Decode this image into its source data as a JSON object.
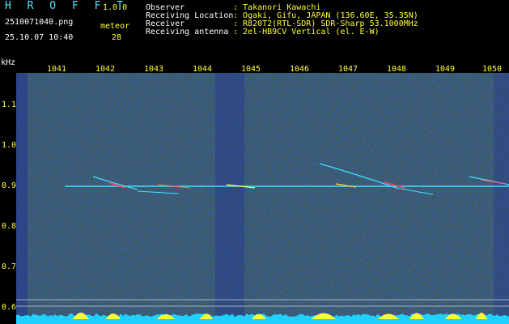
{
  "app": {
    "title": "H R O F F T",
    "version": "1.0.0"
  },
  "file": {
    "name": "2510071040.png",
    "datetime": "25.10.07 10:40"
  },
  "meteor": {
    "label": "meteor",
    "count": "28"
  },
  "info": {
    "labels": [
      "Observer",
      "Receiving Location",
      "Receiver",
      "Receiving antenna"
    ],
    "values": [
      ": Takanori Kawachi",
      ": Ogaki, Gifu, JAPAN (136.60E, 35.35N)",
      ": R820T2(RTL-SDR) SDR-Sharp 53.1000MHz",
      ": 2el-HB9CV Vertical (el. E-W)"
    ]
  },
  "axis": {
    "unit": "kHz",
    "minutes": [
      "1041",
      "1042",
      "1043",
      "1044",
      "1045",
      "1046",
      "1047",
      "1048",
      "1049",
      "1050"
    ],
    "freqs": [
      "1.1",
      "1.0",
      "0.9",
      "0.8",
      "0.7",
      "0.6"
    ]
  },
  "colors": {
    "accent_cyan": "#4fe6ff",
    "label_yellow": "#ffff33",
    "background": "#000000",
    "carrier": "#40e0ff"
  }
}
